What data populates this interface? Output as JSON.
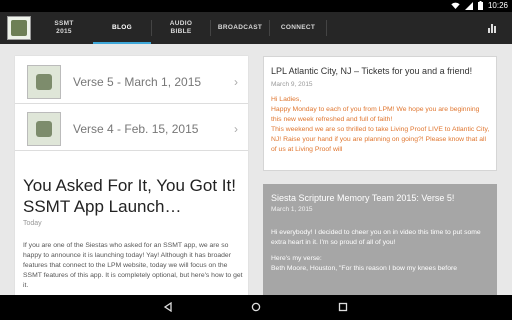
{
  "status_bar": {
    "time": "10:26"
  },
  "app_bar": {
    "tabs": [
      {
        "label": "SSMT\n2015",
        "active": false
      },
      {
        "label": "BLOG",
        "active": true
      },
      {
        "label": "AUDIO\nBIBLE",
        "active": false
      },
      {
        "label": "BROADCAST",
        "active": false
      },
      {
        "label": "CONNECT",
        "active": false
      }
    ],
    "accent_color": "#3ea7d8",
    "chart_icon": "bar-chart-icon"
  },
  "left_column": {
    "verses": [
      {
        "title": "Verse 5 - March 1, 2015"
      },
      {
        "title": "Verse 4 - Feb. 15, 2015"
      }
    ],
    "post": {
      "title": "You Asked For It, You Got It!  SSMT App Launch…",
      "date": "Today",
      "body": "If you are one of the Siestas who asked for an SSMT app, we are so happy to announce it is launching today! Yay! Although it has broader features that connect to the LPM website, today we will focus on the SSMT features of this app.  It is completely optional, but here's how to get it."
    }
  },
  "right_column": {
    "card1": {
      "title": "LPL Atlantic City, NJ – Tickets for you and a friend!",
      "date": "March 9, 2015",
      "body_lines": [
        "Hi Ladies,",
        "Happy Monday to each of you from LPM! We hope you are beginning this new week refreshed and full of faith!",
        "This weekend we are so thrilled to take Living Proof LIVE to Atlantic City, NJ!  Raise your hand if you are planning on going?!  Please know that all of us at Living Proof will"
      ]
    },
    "card2": {
      "title": "Siesta Scripture Memory Team 2015: Verse 5!",
      "date": "March 1, 2015",
      "body_lines": [
        "Hi everybody!  I decided to cheer you on in video this time to put some extra heart in it. I'm so proud of all of you!",
        "Here's my verse:",
        "Beth Moore, Houston, \"For this reason I bow my knees before"
      ]
    }
  },
  "nav_bar": {
    "back": "back-icon",
    "home": "home-icon",
    "recents": "recents-icon"
  }
}
